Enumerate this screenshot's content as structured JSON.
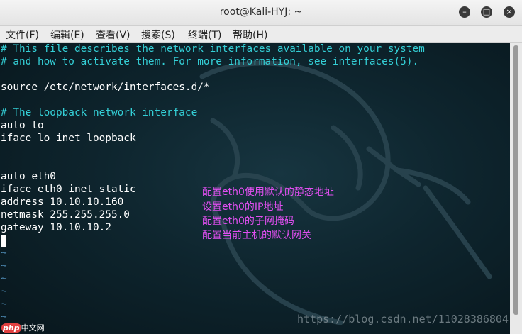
{
  "window": {
    "title": "root@Kali-HYJ: ~",
    "buttons": {
      "minimize": "–",
      "maximize": "□",
      "close": "×"
    }
  },
  "menu": {
    "items": [
      "文件(F)",
      "编辑(E)",
      "查看(V)",
      "搜索(S)",
      "终端(T)",
      "帮助(H)"
    ]
  },
  "terminal": {
    "lines": [
      {
        "text": "# This file describes the network interfaces available on your system",
        "kind": "comment"
      },
      {
        "text": "# and how to activate them. For more information, see interfaces(5).",
        "kind": "comment"
      },
      {
        "text": "",
        "kind": "text"
      },
      {
        "text": "source /etc/network/interfaces.d/*",
        "kind": "text"
      },
      {
        "text": "",
        "kind": "text"
      },
      {
        "text": "# The loopback network interface",
        "kind": "comment"
      },
      {
        "text": "auto lo",
        "kind": "text"
      },
      {
        "text": "iface lo inet loopback",
        "kind": "text"
      },
      {
        "text": "",
        "kind": "text"
      },
      {
        "text": "",
        "kind": "text"
      },
      {
        "text": "auto eth0",
        "kind": "text"
      },
      {
        "text": "iface eth0 inet static",
        "kind": "text"
      },
      {
        "text": "address 10.10.10.160",
        "kind": "text"
      },
      {
        "text": "netmask 255.255.255.0",
        "kind": "text"
      },
      {
        "text": "gateway 10.10.10.2",
        "kind": "text"
      },
      {
        "text": "",
        "kind": "cursor"
      },
      {
        "text": "~",
        "kind": "tilde"
      },
      {
        "text": "~",
        "kind": "tilde"
      },
      {
        "text": "~",
        "kind": "tilde"
      },
      {
        "text": "~",
        "kind": "tilde"
      },
      {
        "text": "~",
        "kind": "tilde"
      },
      {
        "text": "~",
        "kind": "tilde"
      }
    ],
    "annotations": [
      "配置eth0使用默认的静态地址",
      "设置eth0的IP地址",
      "配置eth0的子网掩码",
      "配置当前主机的默认网关"
    ],
    "watermark": "https://blog.csdn.net/11028386804",
    "logo": {
      "badge": "php",
      "text": "中文网"
    }
  },
  "colors": {
    "comment": "#34cfd6",
    "text": "#ffffff",
    "tilde": "#4f8db7",
    "annotation": "#e04ff0"
  }
}
